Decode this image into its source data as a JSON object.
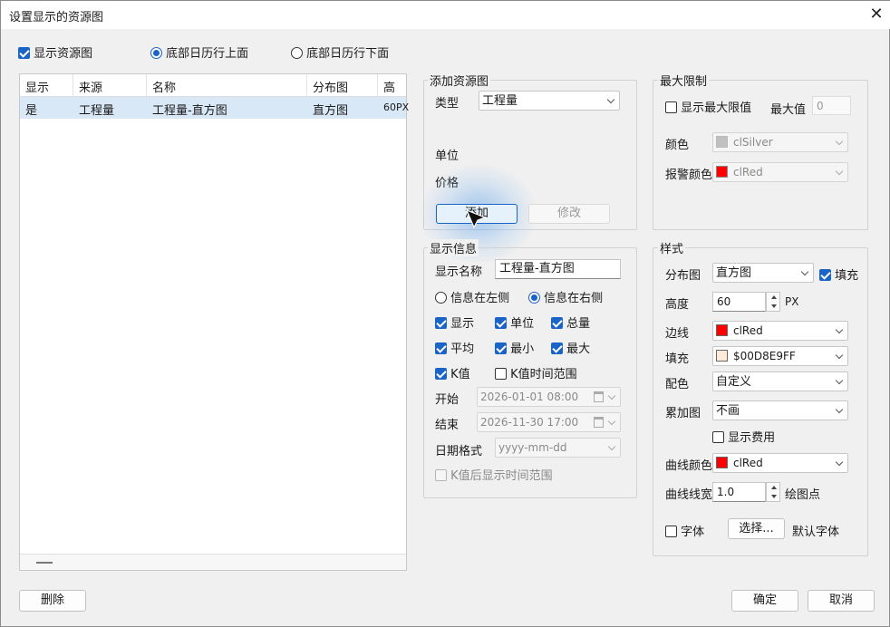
{
  "window": {
    "title": "设置显示的资源图",
    "close": "✕"
  },
  "top_options": {
    "show_resource_chart": {
      "label": "显示资源图",
      "checked": true
    },
    "bottom_above": {
      "label": "底部日历行上面",
      "selected": true
    },
    "bottom_below": {
      "label": "底部日历行下面",
      "selected": false
    }
  },
  "grid": {
    "headers": [
      "显示",
      "来源",
      "名称",
      "分布图",
      "高度"
    ],
    "rows": [
      {
        "show": "是",
        "source": "工程量",
        "name": "工程量-直方图",
        "chart": "直方图",
        "height": "60PX"
      }
    ]
  },
  "add_group": {
    "title": "添加资源图",
    "type_label": "类型",
    "type_value": "工程量",
    "unit_label": "单位",
    "price_label": "价格",
    "add_button": "添加",
    "modify_button": "修改"
  },
  "max_group": {
    "title": "最大限制",
    "show_max": {
      "label": "显示最大限值",
      "checked": false
    },
    "max_label": "最大值",
    "max_value": "0",
    "color_label": "颜色",
    "color_value": "clSilver",
    "color_hex": "#c0c0c0",
    "alarm_label": "报警颜色",
    "alarm_value": "clRed",
    "alarm_hex": "#ff0000"
  },
  "display_group": {
    "title": "显示信息",
    "name_label": "显示名称",
    "name_value": "工程量-直方图",
    "info_left": {
      "label": "信息在左侧",
      "selected": false
    },
    "info_right": {
      "label": "信息在右侧",
      "selected": true
    },
    "checks": [
      {
        "label": "显示",
        "checked": true
      },
      {
        "label": "单位",
        "checked": true
      },
      {
        "label": "总量",
        "checked": true
      },
      {
        "label": "平均",
        "checked": true
      },
      {
        "label": "最小",
        "checked": true
      },
      {
        "label": "最大",
        "checked": true
      },
      {
        "label": "K值",
        "checked": true
      },
      {
        "label": "K值时间范围",
        "checked": false
      }
    ],
    "start_label": "开始",
    "start_value": "2026-01-01 08:00",
    "end_label": "结束",
    "end_value": "2026-11-30 17:00",
    "date_format_label": "日期格式",
    "date_format_value": "yyyy-mm-dd",
    "k_after": {
      "label": "K值后显示时间范围",
      "checked": false
    }
  },
  "style_group": {
    "title": "样式",
    "chart_label": "分布图",
    "chart_value": "直方图",
    "fill_check": {
      "label": "填充",
      "checked": true
    },
    "height_label": "高度",
    "height_value": "60",
    "height_unit": "PX",
    "border_label": "边线",
    "border_value": "clRed",
    "border_hex": "#ff0000",
    "fill_label": "填充",
    "fill_value": "$00D8E9FF",
    "fill_hex": "#ffe9d8",
    "palette_label": "配色",
    "palette_value": "自定义",
    "cumulative_label": "累加图",
    "cumulative_value": "不画",
    "show_cost": {
      "label": "显示费用",
      "checked": false
    },
    "curve_color_label": "曲线颜色",
    "curve_color_value": "clRed",
    "curve_color_hex": "#ff0000",
    "curve_width_label": "曲线线宽",
    "curve_width_value": "1.0",
    "draw_points": "绘图点",
    "font_check": {
      "label": "字体",
      "checked": false
    },
    "font_button": "选择...",
    "default_font": "默认字体"
  },
  "bottom": {
    "delete": "删除",
    "ok": "确定",
    "cancel": "取消"
  }
}
